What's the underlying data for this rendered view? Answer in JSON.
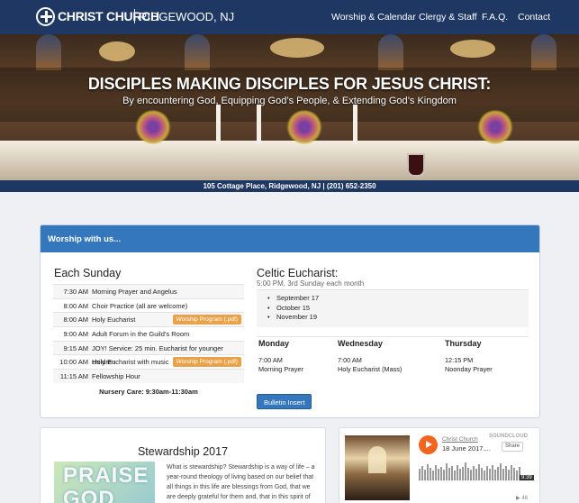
{
  "header": {
    "brand_name": "CHRIST CHURCH",
    "brand_location": "RIDGEWOOD, NJ",
    "nav": [
      "Worship & Calendar",
      "Clergy & Staff",
      "F.A.Q.",
      "Contact"
    ]
  },
  "hero": {
    "title": "DISCIPLES MAKING DISCIPLES FOR JESUS CHRIST:",
    "subtitle": "By encountering God, Equipping God’s People, & Extending God’s Kingdom"
  },
  "address": "105 Cottage Place, Ridgewood, NJ  |  (201) 652-2350",
  "worship": {
    "panel_title": "Worship with us...",
    "each_sunday_heading": "Each Sunday",
    "schedule": [
      {
        "time": "7:30 AM",
        "desc": "Morning Prayer and Angelus",
        "badge": ""
      },
      {
        "time": "8:00 AM",
        "desc": "Choir Practice (all are welcome)",
        "badge": ""
      },
      {
        "time": "8:00 AM",
        "desc": "Holy Eucharist",
        "badge": "Worship Program (.pdf)"
      },
      {
        "time": "9:00 AM",
        "desc": "Adult Forum in the Guild’s Room",
        "badge": ""
      },
      {
        "time": "9:15 AM",
        "desc": "JOY! Service: 25 min. Eucharist for younger children",
        "badge": ""
      },
      {
        "time": "10:00 AM",
        "desc": "Holy Eucharist with music",
        "badge": "Worship Program (.pdf)"
      },
      {
        "time": "11:15 AM",
        "desc": "Fellowship Hour",
        "badge": ""
      }
    ],
    "nursery": "Nursery Care: 9:30am-11:30am",
    "celtic_title": "Celtic Eucharist:",
    "celtic_sub": "5:00 PM, 3rd Sunday each month",
    "celtic_dates": [
      "September 17",
      "October 15",
      "November 19"
    ],
    "weekdays": [
      {
        "day": "Monday",
        "time": "7:00 AM",
        "desc": "Morning Prayer"
      },
      {
        "day": "Wednesday",
        "time": "7:00 AM",
        "desc": "Holy Eucharist (Mass)"
      },
      {
        "day": "Thursday",
        "time": "12:15 PM",
        "desc": "Noonday Prayer"
      }
    ],
    "bulletin_button": "Bulletin Insert"
  },
  "stewardship": {
    "title": "Stewardship 2017",
    "image_text_1": "PRAISE",
    "image_text_2": "GOD",
    "body": "What is stewardship? Stewardship is a way of life – a year-round theology of living based on our belief that all things in this life are blessings from God, that we are deeply grateful for them and, that in this spirit of gratitude, we offer back."
  },
  "soundcloud": {
    "artist": "Christ Church",
    "track": "18 June 2017....",
    "logo": "SOUNDCLOUD",
    "share": "Share",
    "duration": "9:39",
    "plays": "48",
    "accent": "#f2651f"
  }
}
